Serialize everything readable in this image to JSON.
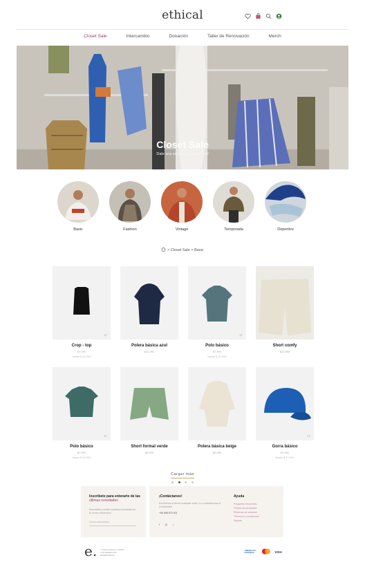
{
  "header": {
    "logo": "ethical",
    "icons": [
      "heart-icon",
      "bag-icon",
      "search-icon",
      "user-icon"
    ]
  },
  "nav": [
    {
      "label": "Closet Sale",
      "active": true
    },
    {
      "label": "Intercambio",
      "active": false
    },
    {
      "label": "Donación",
      "active": false
    },
    {
      "label": "Taller de Renovación",
      "active": false
    },
    {
      "label": "Merch",
      "active": false
    }
  ],
  "hero": {
    "title": "Closet Sale",
    "subtitle": "Dale una segunda oportunidad"
  },
  "categories": [
    {
      "label": "Basic"
    },
    {
      "label": "Fashion"
    },
    {
      "label": "Vintage"
    },
    {
      "label": "Temporada"
    },
    {
      "label": "Deportivo"
    }
  ],
  "breadcrumb": {
    "home_icon": "home-icon",
    "separator": ">",
    "items": [
      "Closet Sale",
      "Basic"
    ]
  },
  "products": [
    {
      "name": "Crop - top",
      "price": "$7.990",
      "price2": "Hasta $ 10.990",
      "tag": "1T"
    },
    {
      "name": "Polera básica azul",
      "price": "$12.990",
      "price2": "",
      "tag": ""
    },
    {
      "name": "Polo básico",
      "price": "$7.990",
      "price2": "Hasta $ 10.990",
      "tag": "1T"
    },
    {
      "name": "Short comfy",
      "price": "$12.990",
      "price2": "",
      "tag": ""
    },
    {
      "name": "Polo básico",
      "price": "$7.990",
      "price2": "Hasta $ 10.990",
      "tag": "1T"
    },
    {
      "name": "Short formal verde",
      "price": "$8.990",
      "price2": "",
      "tag": ""
    },
    {
      "name": "Polera básica beige",
      "price": "$8.990",
      "price2": "",
      "tag": ""
    },
    {
      "name": "Gorra básico",
      "price": "$7.990",
      "price2": "Hasta $ 10.990",
      "tag": "1T"
    }
  ],
  "load_more": "Cargar más",
  "pagination": {
    "count": 4,
    "active": 2
  },
  "footer": {
    "newsletter_title": "Inscríbete para enterarte de las",
    "newsletter_highlight": "últimas novedades",
    "newsletter_text": "Suscríbete y recibe nuestras novedades en tu correo electrónico",
    "newsletter_placeholder": "Correo electrónico",
    "contact_title": "¡Contáctanos!",
    "contact_text": "Escríbenos si tienes cualquier duda. ¡Lo contestaremos a la brevedad!",
    "contact_phone": "+56 988 879 002",
    "help_title": "Ayuda",
    "help_links": [
      "Preguntas frecuentes",
      "Política de privacidad",
      "Reservas de artículos",
      "Términos y condiciones",
      "Soporte"
    ]
  },
  "bottom": {
    "logo": "e.",
    "tagline": "© 2023 ETHICAL TODOS LOS DERECHOS RESERVADOS",
    "payments": [
      "AMERICAN EXPRESS",
      "mastercard",
      "VISA"
    ]
  },
  "colors": {
    "accent": "#9a3e6b",
    "gold": "#c7a76c",
    "footer_bg": "#f6f3ef"
  }
}
